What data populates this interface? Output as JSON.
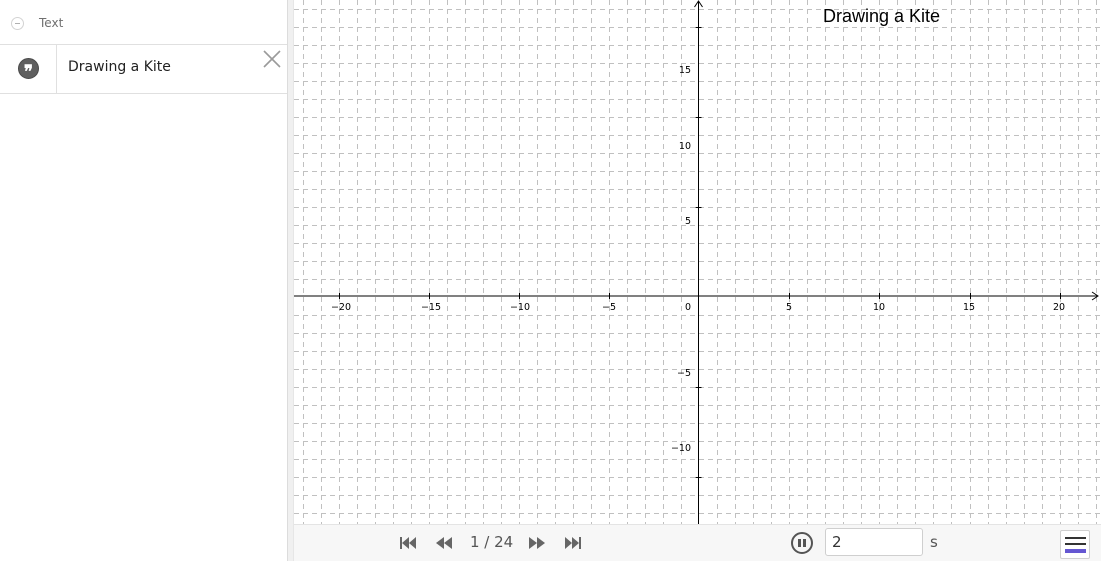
{
  "algebra": {
    "group_label": "Text",
    "items": [
      {
        "text": "Drawing a Kite"
      }
    ]
  },
  "graphics": {
    "title_text": "Drawing a Kite",
    "x_ticks": [
      "−20",
      "−15",
      "−10",
      "−5",
      "0",
      "5",
      "10",
      "15",
      "20"
    ],
    "y_ticks_pos": [
      "15",
      "10",
      "5"
    ],
    "y_ticks_neg": [
      "−5",
      "−10"
    ],
    "x_range": [
      -22.5,
      22.3
    ],
    "y_range": [
      -12.6,
      16.5
    ],
    "grid": "dashed",
    "axis_color": "#000000",
    "grid_color": "#c0c0c0"
  },
  "navigation": {
    "counter": "1 / 24",
    "speed_value": "2",
    "speed_unit": "s"
  },
  "icons": {
    "quote": "quote-icon",
    "close": "close-icon",
    "first": "skip-first-icon",
    "prev": "step-back-icon",
    "next": "step-forward-icon",
    "last": "skip-last-icon",
    "pause": "pause-icon",
    "algebra_toggle": "algebra-view-icon"
  }
}
